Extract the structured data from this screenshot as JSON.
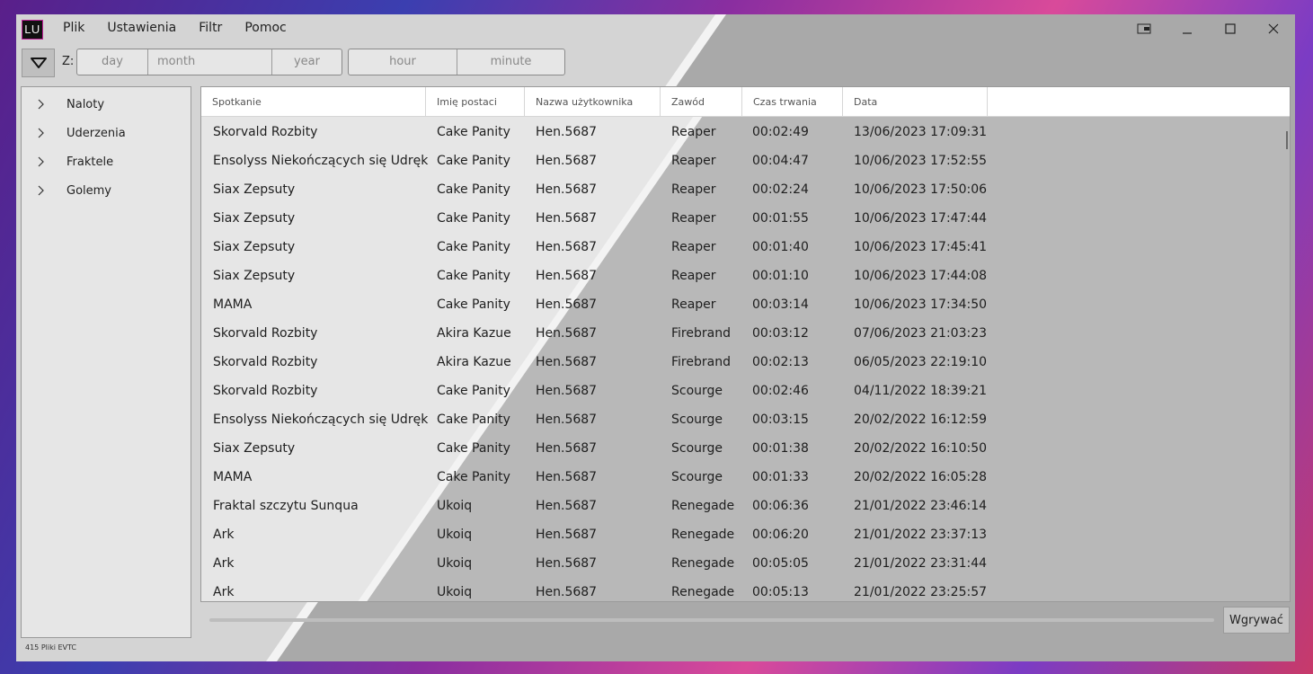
{
  "app": {
    "icon_text": "LU"
  },
  "menu": {
    "items": [
      "Plik",
      "Ustawienia",
      "Filtr",
      "Pomoc"
    ]
  },
  "filter": {
    "z_label": "Z:",
    "day_placeholder": "day",
    "month_placeholder": "month",
    "year_placeholder": "year",
    "hour_placeholder": "hour",
    "minute_placeholder": "minute"
  },
  "sidebar": {
    "items": [
      "Naloty",
      "Uderzenia",
      "Fraktele",
      "Golemy"
    ]
  },
  "status": {
    "text": "415  Pliki EVTC"
  },
  "table": {
    "headers": [
      "Spotkanie",
      "Imię postaci",
      "Nazwa użytkownika",
      "Zawód",
      "Czas trwania",
      "Data"
    ],
    "rows": [
      [
        "Skorvald Rozbity",
        "Cake Panity",
        "Hen.5687",
        "Reaper",
        "00:02:49",
        "13/06/2023 17:09:31"
      ],
      [
        "Ensolyss Niekończących się Udręk",
        "Cake Panity",
        "Hen.5687",
        "Reaper",
        "00:04:47",
        "10/06/2023 17:52:55"
      ],
      [
        "Siax Zepsuty",
        "Cake Panity",
        "Hen.5687",
        "Reaper",
        "00:02:24",
        "10/06/2023 17:50:06"
      ],
      [
        "Siax Zepsuty",
        "Cake Panity",
        "Hen.5687",
        "Reaper",
        "00:01:55",
        "10/06/2023 17:47:44"
      ],
      [
        "Siax Zepsuty",
        "Cake Panity",
        "Hen.5687",
        "Reaper",
        "00:01:40",
        "10/06/2023 17:45:41"
      ],
      [
        "Siax Zepsuty",
        "Cake Panity",
        "Hen.5687",
        "Reaper",
        "00:01:10",
        "10/06/2023 17:44:08"
      ],
      [
        "MAMA",
        "Cake Panity",
        "Hen.5687",
        "Reaper",
        "00:03:14",
        "10/06/2023 17:34:50"
      ],
      [
        "Skorvald Rozbity",
        "Akira Kazue",
        "Hen.5687",
        "Firebrand",
        "00:03:12",
        "07/06/2023 21:03:23"
      ],
      [
        "Skorvald Rozbity",
        "Akira Kazue",
        "Hen.5687",
        "Firebrand",
        "00:02:13",
        "06/05/2023 22:19:10"
      ],
      [
        "Skorvald Rozbity",
        "Cake Panity",
        "Hen.5687",
        "Scourge",
        "00:02:46",
        "04/11/2022 18:39:21"
      ],
      [
        "Ensolyss Niekończących się Udręk",
        "Cake Panity",
        "Hen.5687",
        "Scourge",
        "00:03:15",
        "20/02/2022 16:12:59"
      ],
      [
        "Siax Zepsuty",
        "Cake Panity",
        "Hen.5687",
        "Scourge",
        "00:01:38",
        "20/02/2022 16:10:50"
      ],
      [
        "MAMA",
        "Cake Panity",
        "Hen.5687",
        "Scourge",
        "00:01:33",
        "20/02/2022 16:05:28"
      ],
      [
        "Fraktal szczytu Sunqua",
        "Ukoiq",
        "Hen.5687",
        "Renegade",
        "00:06:36",
        "21/01/2022 23:46:14"
      ],
      [
        "Ark",
        "Ukoiq",
        "Hen.5687",
        "Renegade",
        "00:06:20",
        "21/01/2022 23:37:13"
      ],
      [
        "Ark",
        "Ukoiq",
        "Hen.5687",
        "Renegade",
        "00:05:05",
        "21/01/2022 23:31:44"
      ],
      [
        "Ark",
        "Ukoiq",
        "Hen.5687",
        "Renegade",
        "00:05:13",
        "21/01/2022 23:25:57"
      ]
    ]
  },
  "actions": {
    "upload_label": "Wgrywać"
  }
}
